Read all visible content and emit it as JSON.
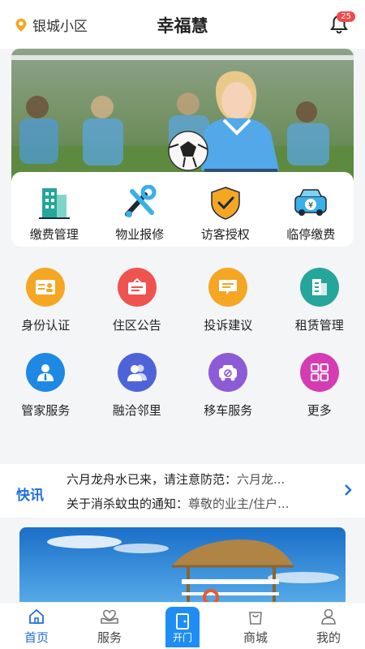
{
  "header": {
    "location": "银城小区",
    "title": "幸福慧",
    "notification_count": "25"
  },
  "quick_actions": [
    {
      "label": "缴费管理",
      "icon": "building-icon"
    },
    {
      "label": "物业报修",
      "icon": "wrench-screwdriver-icon"
    },
    {
      "label": "访客授权",
      "icon": "shield-check-icon"
    },
    {
      "label": "临停缴费",
      "icon": "car-yuan-icon"
    }
  ],
  "services": [
    {
      "label": "身份认证",
      "icon": "id-card-icon",
      "color": "#f5a623"
    },
    {
      "label": "住区公告",
      "icon": "notice-board-icon",
      "color": "#ef5350"
    },
    {
      "label": "投诉建议",
      "icon": "message-icon",
      "color": "#f5a623"
    },
    {
      "label": "租赁管理",
      "icon": "building-doc-icon",
      "color": "#26a69a"
    },
    {
      "label": "管家服务",
      "icon": "butler-icon",
      "color": "#1e88e5"
    },
    {
      "label": "融洽邻里",
      "icon": "neighbors-icon",
      "color": "#4f63d9"
    },
    {
      "label": "移车服务",
      "icon": "move-car-icon",
      "color": "#8e5bd6"
    },
    {
      "label": "更多",
      "icon": "grid-icon",
      "color": "#d53cb4"
    }
  ],
  "news": {
    "tag": "快讯",
    "items": [
      {
        "title": "六月龙舟水已来，请注意防范：",
        "summary": "六月龙..."
      },
      {
        "title": "关于消杀蚊虫的通知：",
        "summary": "尊敬的业主/住户..."
      }
    ]
  },
  "tabs": [
    {
      "label": "首页",
      "icon": "home-icon"
    },
    {
      "label": "服务",
      "icon": "service-hands-icon"
    },
    {
      "label": "开门",
      "icon": "door-icon"
    },
    {
      "label": "商城",
      "icon": "shopping-bag-icon"
    },
    {
      "label": "我的",
      "icon": "user-icon"
    }
  ],
  "colors": {
    "accent": "#1e6fd9",
    "badge": "#f04b4b",
    "open_button": "#1e8ef5"
  }
}
